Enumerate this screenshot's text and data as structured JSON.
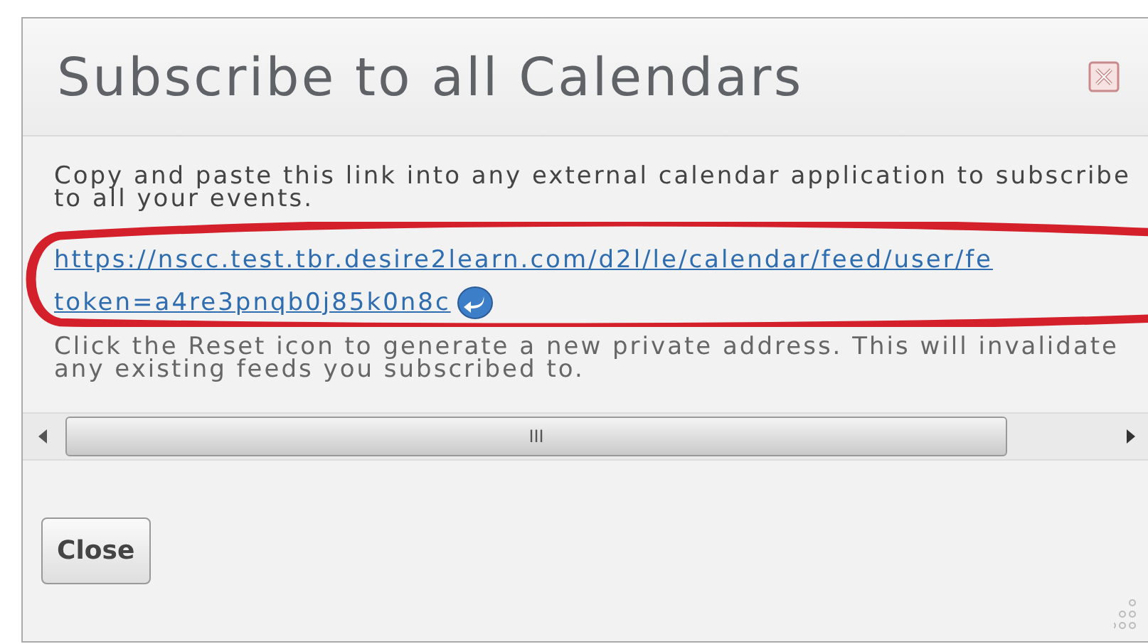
{
  "dialog": {
    "title": "Subscribe to all Calendars",
    "intro": "Copy and paste this link into any external calendar application to subscribe to all your events.",
    "link_lines": [
      "https://nscc.test.tbr.desire2learn.com/d2l/le/calendar/feed/user/fe",
      "token=a4re3pnqb0j85k0n8c"
    ],
    "reset_note": "Click the Reset icon to generate a new private address. This will invalidate any existing feeds you subscribed to.",
    "scrollbar_grip": "III",
    "buttons": [
      "Close"
    ]
  }
}
